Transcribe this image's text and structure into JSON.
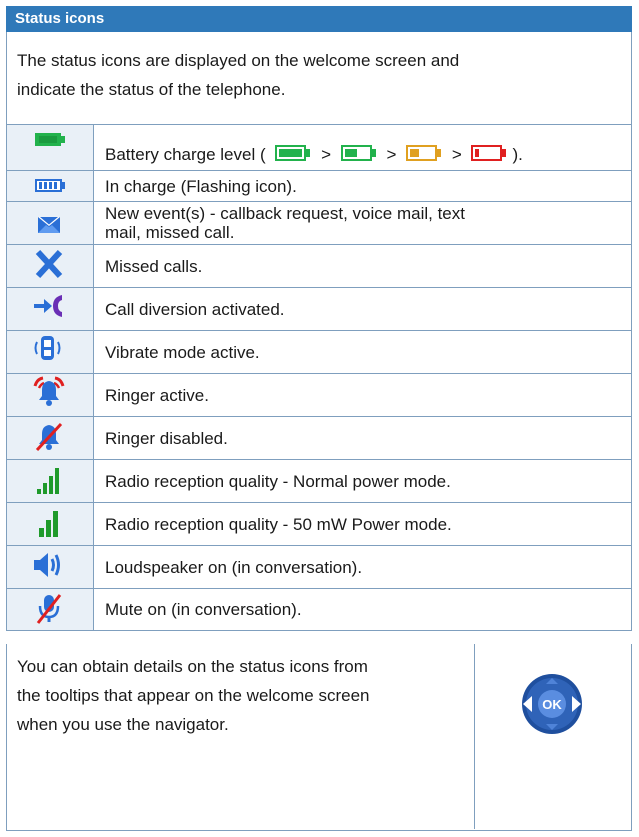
{
  "header": {
    "title": "Status icons"
  },
  "intro": {
    "line1": "The status icons are displayed on the welcome screen and",
    "line2": "indicate the status of the telephone."
  },
  "rows": [
    {
      "icon": "battery-full-icon",
      "pre": "Battery charge level ( ",
      "sep1": " > ",
      "sep2": " > ",
      "sep3": " > ",
      "post": ")."
    },
    {
      "icon": "battery-charging-icon",
      "text": "In charge (Flashing icon)."
    },
    {
      "icon": "envelope-icon",
      "line1": "New event(s) - callback request, voice mail, text",
      "line2": "mail, missed call."
    },
    {
      "icon": "missed-call-x-icon",
      "text": "Missed calls."
    },
    {
      "icon": "call-diversion-icon",
      "text": "Call diversion activated."
    },
    {
      "icon": "vibrate-icon",
      "text": "Vibrate mode active."
    },
    {
      "icon": "ringer-active-icon",
      "text": "Ringer active."
    },
    {
      "icon": "ringer-disabled-icon",
      "text": "Ringer disabled."
    },
    {
      "icon": "signal-normal-icon",
      "text": "Radio reception quality - Normal power mode."
    },
    {
      "icon": "signal-50mw-icon",
      "text": "Radio reception quality - 50 mW Power mode."
    },
    {
      "icon": "loudspeaker-icon",
      "text": "Loudspeaker on (in conversation)."
    },
    {
      "icon": "mute-icon",
      "text": "Mute on (in conversation)."
    }
  ],
  "bottom": {
    "line1": "You can obtain details on the status icons from",
    "line2": "the tooltips that appear on the welcome screen",
    "line3": "when you use the navigator.",
    "ok_label": "OK"
  },
  "colors": {
    "header_bg": "#2f79b9",
    "battery_green": "#22b24c",
    "battery_orange": "#e0a020",
    "battery_red": "#e02020",
    "icon_blue": "#2a6fd6",
    "icon_purple": "#6a2fb5",
    "icon_red": "#e02020",
    "signal_green": "#1f9a2b"
  }
}
